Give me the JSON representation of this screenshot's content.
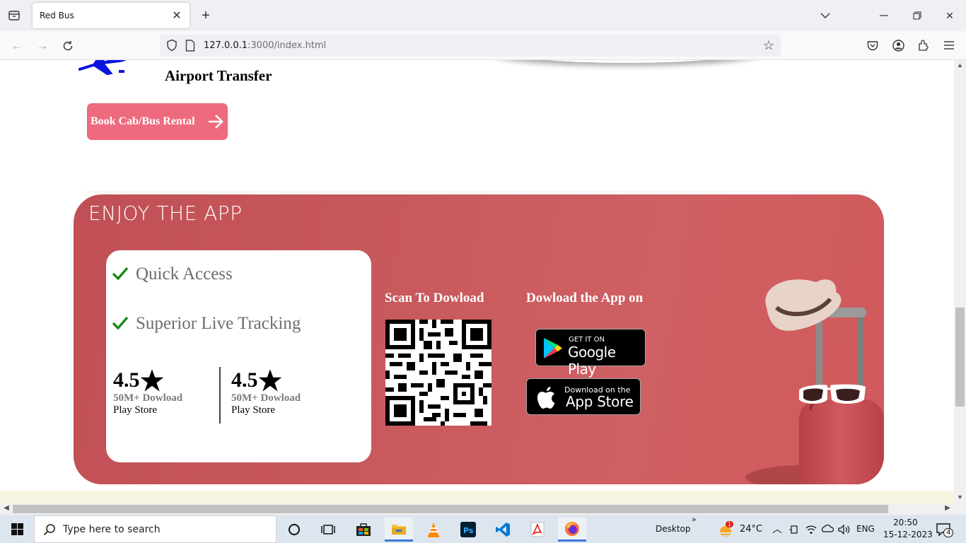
{
  "browser": {
    "tab_title": "Red Bus",
    "url_host": "127.0.0.1",
    "url_path": ":3000/index.html"
  },
  "page": {
    "airport_title": "Airport Transfer",
    "book_button": "Book Cab/Bus Rental",
    "enjoy_title": "ENJOY THE APP",
    "features": [
      "Quick Access",
      "Superior Live Tracking"
    ],
    "ratings": [
      {
        "value": "4.5",
        "downloads": "50M+ Dowload",
        "store": "Play Store"
      },
      {
        "value": "4.5",
        "downloads": "50M+ Dowload",
        "store": "Play Store"
      }
    ],
    "scan_title": "Scan To Dowload",
    "download_title": "Dowload the App on",
    "google_play": {
      "small": "GET IT ON",
      "big": "Google Play"
    },
    "app_store": {
      "small": "Download on the",
      "big": "App Store"
    },
    "colors": {
      "accent_button": "#ee6a7e",
      "enjoy_bg": "#c95a5d",
      "check": "#1a8a1a"
    }
  },
  "taskbar": {
    "search_placeholder": "Type here to search",
    "desktop_label": "Desktop",
    "temperature": "24°C",
    "language": "ENG",
    "time": "20:50",
    "date": "15-12-2023",
    "notifications": "4",
    "weather_badge": "1"
  }
}
